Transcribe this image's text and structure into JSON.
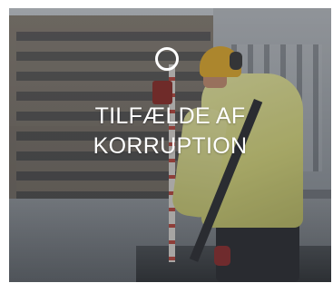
{
  "tile": {
    "title_line1": "TILFÆLDE AF",
    "title_line2": "KORRUPTION",
    "icon": "circle-outline-icon",
    "text_color": "#ffffff",
    "overlay_color": "rgba(40,44,50,0.28)"
  }
}
